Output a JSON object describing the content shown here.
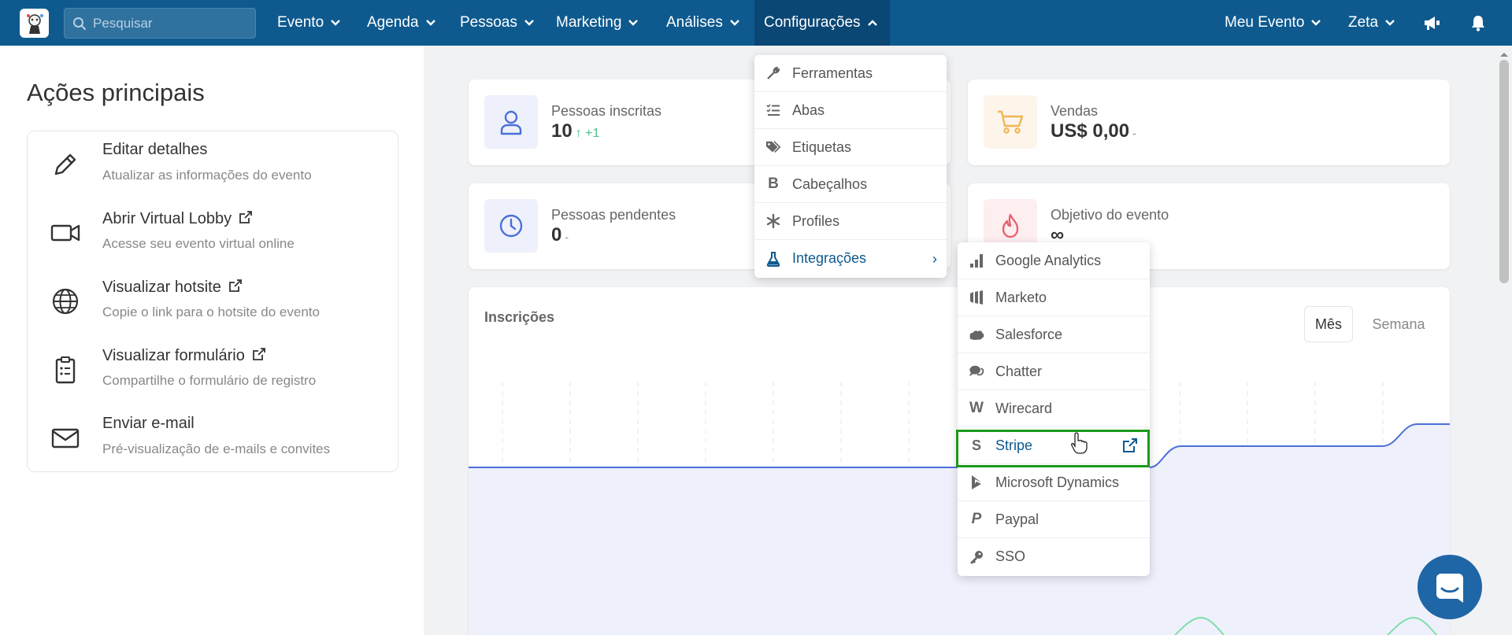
{
  "search": {
    "placeholder": "Pesquisar"
  },
  "nav": {
    "items": [
      {
        "label": "Evento"
      },
      {
        "label": "Agenda"
      },
      {
        "label": "Pessoas"
      },
      {
        "label": "Marketing"
      },
      {
        "label": "Análises"
      },
      {
        "label": "Configurações"
      }
    ],
    "right": [
      {
        "label": "Meu Evento"
      },
      {
        "label": "Zeta"
      }
    ]
  },
  "left": {
    "title": "Ações principais",
    "actions": [
      {
        "title": "Editar detalhes",
        "subtitle": "Atualizar as informações do evento",
        "icon": "pencil-icon"
      },
      {
        "title": "Abrir Virtual Lobby",
        "subtitle": "Acesse seu evento virtual online",
        "icon": "video-camera-icon"
      },
      {
        "title": "Visualizar hotsite",
        "subtitle": "Copie o link para o hotsite do evento",
        "icon": "globe-icon"
      },
      {
        "title": "Visualizar formulário",
        "subtitle": "Compartilhe o formulário de registro",
        "icon": "clipboard-icon"
      },
      {
        "title": "Enviar e-mail",
        "subtitle": "Pré-visualização de e-mails e convites",
        "icon": "envelope-icon"
      }
    ]
  },
  "stats": [
    {
      "label": "Pessoas inscritas",
      "value": "10",
      "delta": "+1"
    },
    {
      "label": "Vendas",
      "value": "US$ 0,00",
      "delta": "-"
    },
    {
      "label": "Pessoas pendentes",
      "value": "0",
      "delta": "-"
    },
    {
      "label": "Objetivo do evento",
      "value": "∞"
    }
  ],
  "chart": {
    "title": "Inscrições",
    "toggle": [
      "Mês",
      "Semana"
    ],
    "selected": "Mês"
  },
  "config_menu": [
    {
      "label": "Ferramentas",
      "icon": "wrench-icon"
    },
    {
      "label": "Abas",
      "icon": "list-check-icon"
    },
    {
      "label": "Etiquetas",
      "icon": "tags-icon"
    },
    {
      "label": "Cabeçalhos",
      "icon": "bold-icon"
    },
    {
      "label": "Profiles",
      "icon": "asterisk-icon"
    },
    {
      "label": "Integrações",
      "icon": "flask-icon",
      "arrow": "›"
    }
  ],
  "integrations_menu": [
    {
      "label": "Google Analytics",
      "icon": "signal-bars-icon"
    },
    {
      "label": "Marketo",
      "icon": "marketo-icon"
    },
    {
      "label": "Salesforce",
      "icon": "cloud-icon"
    },
    {
      "label": "Chatter",
      "icon": "comments-icon"
    },
    {
      "label": "Wirecard",
      "icon": "wirecard-icon"
    },
    {
      "label": "Stripe",
      "icon": "stripe-icon"
    },
    {
      "label": "Microsoft Dynamics",
      "icon": "dynamics-icon"
    },
    {
      "label": "Paypal",
      "icon": "paypal-icon"
    },
    {
      "label": "SSO",
      "icon": "key-icon"
    }
  ],
  "colors": {
    "nav": "#0e5a8f",
    "accent": "#4a6fd8",
    "highlight": "#1a9a1a"
  }
}
